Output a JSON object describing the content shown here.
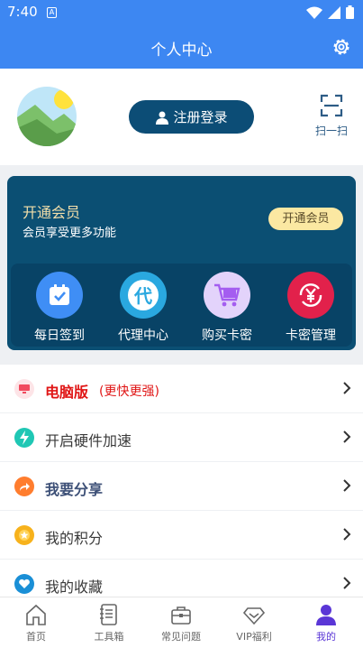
{
  "status_bar": {
    "time": "7:40",
    "sim_glyph": "A"
  },
  "header": {
    "title": "个人中心"
  },
  "profile": {
    "login_label": "注册登录",
    "scan_label": "扫一扫"
  },
  "vip": {
    "title": "开通会员",
    "subtitle": "会员享受更多功能",
    "button_label": "开通会员",
    "items": [
      {
        "label": "每日签到",
        "icon": "calendar-check-icon",
        "color": "#3f8ef5"
      },
      {
        "label": "代理中心",
        "icon": "agent-icon",
        "color": "#2aa8e0"
      },
      {
        "label": "购买卡密",
        "icon": "cart-icon",
        "color": "#e3d3fb"
      },
      {
        "label": "卡密管理",
        "icon": "yen-exchange-icon",
        "color": "#e2214b"
      }
    ]
  },
  "list": [
    {
      "label": "电脑版",
      "extra": "(更快更强)",
      "icon": "monitor-icon",
      "color": "#f14a5e"
    },
    {
      "label": "开启硬件加速",
      "icon": "lightning-icon",
      "color": "#1fc7b4"
    },
    {
      "label": "我要分享",
      "icon": "share-icon",
      "color": "#ff7d2e"
    },
    {
      "label": "我的积分",
      "icon": "star-coin-icon",
      "color": "#f7b21c"
    },
    {
      "label": "我的收藏",
      "icon": "heart-icon",
      "color": "#1a8fd6"
    }
  ],
  "tabs": [
    {
      "label": "首页",
      "icon": "home-icon"
    },
    {
      "label": "工具箱",
      "icon": "toolbox-doc-icon"
    },
    {
      "label": "常见问题",
      "icon": "briefcase-icon"
    },
    {
      "label": "VIP福利",
      "icon": "diamond-icon"
    },
    {
      "label": "我的",
      "icon": "user-icon",
      "active": true
    }
  ]
}
